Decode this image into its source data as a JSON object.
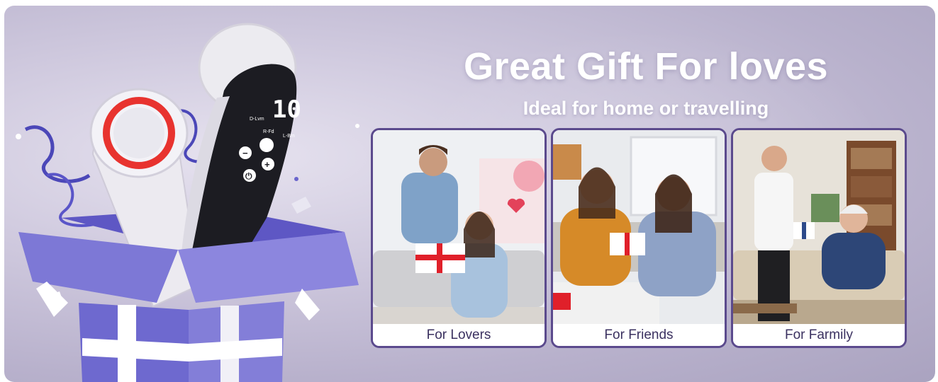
{
  "headline": "Great Gift For loves",
  "subheadline": "Ideal for home or travelling",
  "cards": [
    {
      "caption": "For Lovers",
      "scene": "couple-gift-photo"
    },
    {
      "caption": "For Friends",
      "scene": "friends-gift-photo"
    },
    {
      "caption": "For Farmily",
      "scene": "family-gift-photo"
    }
  ],
  "device": {
    "display_digits": "10",
    "mode_labels": [
      "D-Lvm",
      "R-Fd",
      "L-Bm"
    ]
  },
  "colors": {
    "card_border": "#5b4a8d",
    "gift_box": "#7d78d6",
    "ribbon": "#ffffff",
    "red_light": "#e8332f"
  }
}
